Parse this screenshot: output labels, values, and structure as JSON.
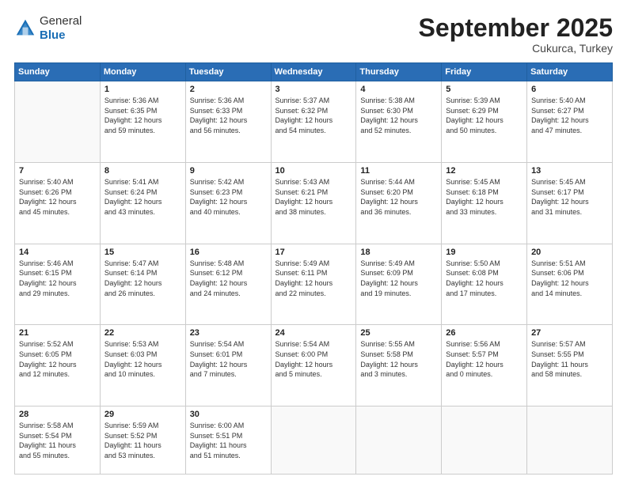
{
  "header": {
    "logo_line1": "General",
    "logo_line2": "Blue",
    "month": "September 2025",
    "location": "Cukurca, Turkey"
  },
  "weekdays": [
    "Sunday",
    "Monday",
    "Tuesday",
    "Wednesday",
    "Thursday",
    "Friday",
    "Saturday"
  ],
  "weeks": [
    [
      {
        "day": "",
        "info": ""
      },
      {
        "day": "1",
        "info": "Sunrise: 5:36 AM\nSunset: 6:35 PM\nDaylight: 12 hours\nand 59 minutes."
      },
      {
        "day": "2",
        "info": "Sunrise: 5:36 AM\nSunset: 6:33 PM\nDaylight: 12 hours\nand 56 minutes."
      },
      {
        "day": "3",
        "info": "Sunrise: 5:37 AM\nSunset: 6:32 PM\nDaylight: 12 hours\nand 54 minutes."
      },
      {
        "day": "4",
        "info": "Sunrise: 5:38 AM\nSunset: 6:30 PM\nDaylight: 12 hours\nand 52 minutes."
      },
      {
        "day": "5",
        "info": "Sunrise: 5:39 AM\nSunset: 6:29 PM\nDaylight: 12 hours\nand 50 minutes."
      },
      {
        "day": "6",
        "info": "Sunrise: 5:40 AM\nSunset: 6:27 PM\nDaylight: 12 hours\nand 47 minutes."
      }
    ],
    [
      {
        "day": "7",
        "info": "Sunrise: 5:40 AM\nSunset: 6:26 PM\nDaylight: 12 hours\nand 45 minutes."
      },
      {
        "day": "8",
        "info": "Sunrise: 5:41 AM\nSunset: 6:24 PM\nDaylight: 12 hours\nand 43 minutes."
      },
      {
        "day": "9",
        "info": "Sunrise: 5:42 AM\nSunset: 6:23 PM\nDaylight: 12 hours\nand 40 minutes."
      },
      {
        "day": "10",
        "info": "Sunrise: 5:43 AM\nSunset: 6:21 PM\nDaylight: 12 hours\nand 38 minutes."
      },
      {
        "day": "11",
        "info": "Sunrise: 5:44 AM\nSunset: 6:20 PM\nDaylight: 12 hours\nand 36 minutes."
      },
      {
        "day": "12",
        "info": "Sunrise: 5:45 AM\nSunset: 6:18 PM\nDaylight: 12 hours\nand 33 minutes."
      },
      {
        "day": "13",
        "info": "Sunrise: 5:45 AM\nSunset: 6:17 PM\nDaylight: 12 hours\nand 31 minutes."
      }
    ],
    [
      {
        "day": "14",
        "info": "Sunrise: 5:46 AM\nSunset: 6:15 PM\nDaylight: 12 hours\nand 29 minutes."
      },
      {
        "day": "15",
        "info": "Sunrise: 5:47 AM\nSunset: 6:14 PM\nDaylight: 12 hours\nand 26 minutes."
      },
      {
        "day": "16",
        "info": "Sunrise: 5:48 AM\nSunset: 6:12 PM\nDaylight: 12 hours\nand 24 minutes."
      },
      {
        "day": "17",
        "info": "Sunrise: 5:49 AM\nSunset: 6:11 PM\nDaylight: 12 hours\nand 22 minutes."
      },
      {
        "day": "18",
        "info": "Sunrise: 5:49 AM\nSunset: 6:09 PM\nDaylight: 12 hours\nand 19 minutes."
      },
      {
        "day": "19",
        "info": "Sunrise: 5:50 AM\nSunset: 6:08 PM\nDaylight: 12 hours\nand 17 minutes."
      },
      {
        "day": "20",
        "info": "Sunrise: 5:51 AM\nSunset: 6:06 PM\nDaylight: 12 hours\nand 14 minutes."
      }
    ],
    [
      {
        "day": "21",
        "info": "Sunrise: 5:52 AM\nSunset: 6:05 PM\nDaylight: 12 hours\nand 12 minutes."
      },
      {
        "day": "22",
        "info": "Sunrise: 5:53 AM\nSunset: 6:03 PM\nDaylight: 12 hours\nand 10 minutes."
      },
      {
        "day": "23",
        "info": "Sunrise: 5:54 AM\nSunset: 6:01 PM\nDaylight: 12 hours\nand 7 minutes."
      },
      {
        "day": "24",
        "info": "Sunrise: 5:54 AM\nSunset: 6:00 PM\nDaylight: 12 hours\nand 5 minutes."
      },
      {
        "day": "25",
        "info": "Sunrise: 5:55 AM\nSunset: 5:58 PM\nDaylight: 12 hours\nand 3 minutes."
      },
      {
        "day": "26",
        "info": "Sunrise: 5:56 AM\nSunset: 5:57 PM\nDaylight: 12 hours\nand 0 minutes."
      },
      {
        "day": "27",
        "info": "Sunrise: 5:57 AM\nSunset: 5:55 PM\nDaylight: 11 hours\nand 58 minutes."
      }
    ],
    [
      {
        "day": "28",
        "info": "Sunrise: 5:58 AM\nSunset: 5:54 PM\nDaylight: 11 hours\nand 55 minutes."
      },
      {
        "day": "29",
        "info": "Sunrise: 5:59 AM\nSunset: 5:52 PM\nDaylight: 11 hours\nand 53 minutes."
      },
      {
        "day": "30",
        "info": "Sunrise: 6:00 AM\nSunset: 5:51 PM\nDaylight: 11 hours\nand 51 minutes."
      },
      {
        "day": "",
        "info": ""
      },
      {
        "day": "",
        "info": ""
      },
      {
        "day": "",
        "info": ""
      },
      {
        "day": "",
        "info": ""
      }
    ]
  ]
}
